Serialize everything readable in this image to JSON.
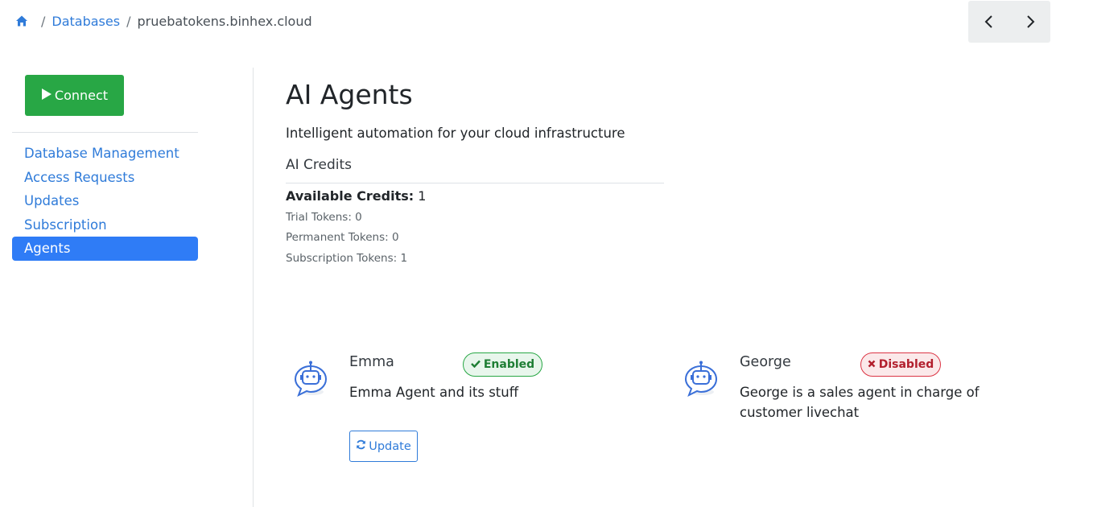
{
  "breadcrumb": {
    "home_icon": "home-icon",
    "items": [
      "Databases",
      "pruebatokens.binhex.cloud"
    ]
  },
  "nav": {
    "prev_icon": "chevron-left-icon",
    "next_icon": "chevron-right-icon"
  },
  "sidebar": {
    "connect_label": "Connect",
    "items": [
      {
        "label": "Database Management"
      },
      {
        "label": "Access Requests"
      },
      {
        "label": "Updates"
      },
      {
        "label": "Subscription"
      },
      {
        "label": "Agents",
        "active": true
      }
    ]
  },
  "main": {
    "title": "AI Agents",
    "subtitle": "Intelligent automation for your cloud infrastructure",
    "credits": {
      "title": "AI Credits",
      "available_label": "Available Credits:",
      "available_value": "1",
      "trial": "Trial Tokens: 0",
      "permanent": "Permanent Tokens: 0",
      "subscription": "Subscription Tokens: 1"
    },
    "agents": [
      {
        "name": "Emma",
        "status": "Enabled",
        "description": "Emma Agent and its stuff",
        "update_label": "Update"
      },
      {
        "name": "George",
        "status": "Disabled",
        "description_line1": "George is a sales agent in charge of",
        "description_line2": "customer livechat"
      }
    ]
  },
  "colors": {
    "link": "#2f7bd9",
    "connect": "#28a745",
    "active_nav": "#2f7cf6",
    "enabled": "#28a745",
    "disabled": "#dc3545"
  }
}
